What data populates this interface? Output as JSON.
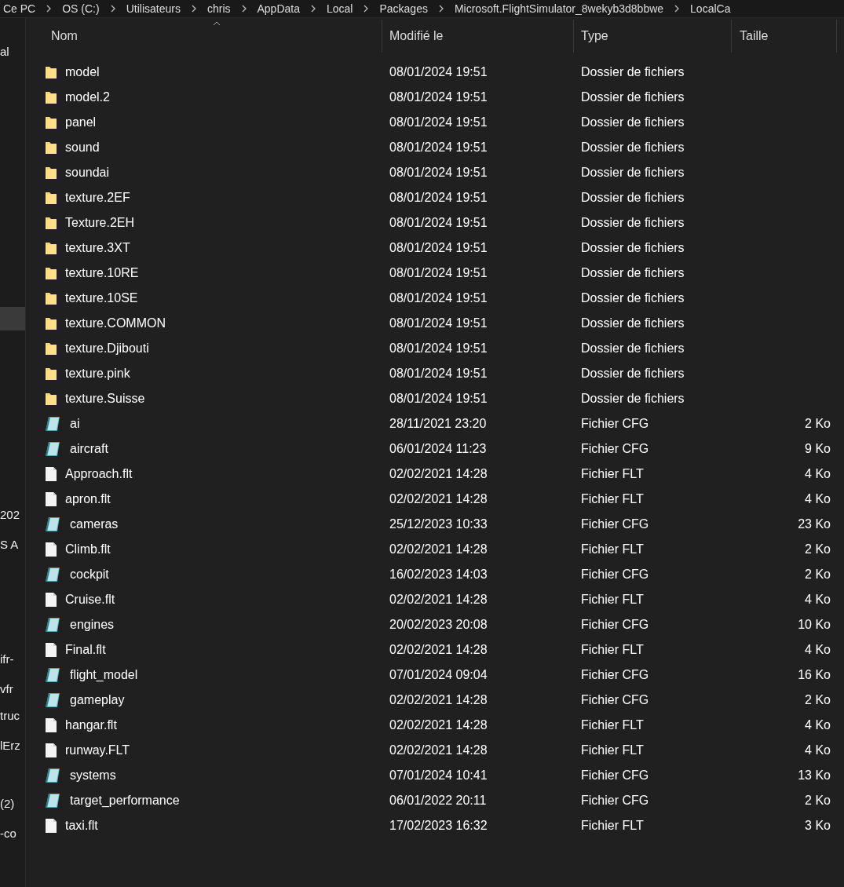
{
  "breadcrumb": [
    "Ce PC",
    "OS (C:)",
    "Utilisateurs",
    "chris",
    "AppData",
    "Local",
    "Packages",
    "Microsoft.FlightSimulator_8wekyb3d8bbwe",
    "LocalCa"
  ],
  "sidebar": {
    "items": [
      {
        "label": "al",
        "selected": false
      },
      {
        "selected": true
      },
      {
        "label": "202",
        "selected": false
      },
      {
        "label": "S A",
        "selected": false
      },
      {
        "label": "ifr-",
        "selected": false
      },
      {
        "label": "vfr",
        "selected": false
      },
      {
        "label": "truc",
        "selected": false
      },
      {
        "label": "lErz",
        "selected": false
      },
      {
        "label": "(2)",
        "selected": false
      },
      {
        "label": "-co",
        "selected": false
      }
    ]
  },
  "table": {
    "columns": [
      {
        "label": "Nom",
        "sorted": true
      },
      {
        "label": "Modifié le",
        "sorted": false
      },
      {
        "label": "Type",
        "sorted": false
      },
      {
        "label": "Taille",
        "sorted": false
      }
    ],
    "rows": [
      {
        "kind": "folder",
        "name": "model",
        "modified": "08/01/2024 19:51",
        "type": "Dossier de fichiers"
      },
      {
        "kind": "folder",
        "name": "model.2",
        "modified": "08/01/2024 19:51",
        "type": "Dossier de fichiers"
      },
      {
        "kind": "folder",
        "name": "panel",
        "modified": "08/01/2024 19:51",
        "type": "Dossier de fichiers"
      },
      {
        "kind": "folder",
        "name": "sound",
        "modified": "08/01/2024 19:51",
        "type": "Dossier de fichiers"
      },
      {
        "kind": "folder",
        "name": "soundai",
        "modified": "08/01/2024 19:51",
        "type": "Dossier de fichiers"
      },
      {
        "kind": "folder",
        "name": "texture.2EF",
        "modified": "08/01/2024 19:51",
        "type": "Dossier de fichiers"
      },
      {
        "kind": "folder",
        "name": "Texture.2EH",
        "modified": "08/01/2024 19:51",
        "type": "Dossier de fichiers"
      },
      {
        "kind": "folder",
        "name": "texture.3XT",
        "modified": "08/01/2024 19:51",
        "type": "Dossier de fichiers"
      },
      {
        "kind": "folder",
        "name": "texture.10RE",
        "modified": "08/01/2024 19:51",
        "type": "Dossier de fichiers"
      },
      {
        "kind": "folder",
        "name": "texture.10SE",
        "modified": "08/01/2024 19:51",
        "type": "Dossier de fichiers"
      },
      {
        "kind": "folder",
        "name": "texture.COMMON",
        "modified": "08/01/2024 19:51",
        "type": "Dossier de fichiers"
      },
      {
        "kind": "folder",
        "name": "texture.Djibouti",
        "modified": "08/01/2024 19:51",
        "type": "Dossier de fichiers"
      },
      {
        "kind": "folder",
        "name": "texture.pink",
        "modified": "08/01/2024 19:51",
        "type": "Dossier de fichiers"
      },
      {
        "kind": "folder",
        "name": "texture.Suisse",
        "modified": "08/01/2024 19:51",
        "type": "Dossier de fichiers"
      },
      {
        "kind": "cfg",
        "name": "ai",
        "modified": "28/11/2021 23:20",
        "type": "Fichier CFG",
        "size": "2 Ko"
      },
      {
        "kind": "cfg",
        "name": "aircraft",
        "modified": "06/01/2024 11:23",
        "type": "Fichier CFG",
        "size": "9 Ko"
      },
      {
        "kind": "file",
        "name": "Approach.flt",
        "modified": "02/02/2021 14:28",
        "type": "Fichier FLT",
        "size": "4 Ko"
      },
      {
        "kind": "file",
        "name": "apron.flt",
        "modified": "02/02/2021 14:28",
        "type": "Fichier FLT",
        "size": "4 Ko"
      },
      {
        "kind": "cfg",
        "name": "cameras",
        "modified": "25/12/2023 10:33",
        "type": "Fichier CFG",
        "size": "23 Ko"
      },
      {
        "kind": "file",
        "name": "Climb.flt",
        "modified": "02/02/2021 14:28",
        "type": "Fichier FLT",
        "size": "2 Ko"
      },
      {
        "kind": "cfg",
        "name": "cockpit",
        "modified": "16/02/2023 14:03",
        "type": "Fichier CFG",
        "size": "2 Ko"
      },
      {
        "kind": "file",
        "name": "Cruise.flt",
        "modified": "02/02/2021 14:28",
        "type": "Fichier FLT",
        "size": "4 Ko"
      },
      {
        "kind": "cfg",
        "name": "engines",
        "modified": "20/02/2023 20:08",
        "type": "Fichier CFG",
        "size": "10 Ko"
      },
      {
        "kind": "file",
        "name": "Final.flt",
        "modified": "02/02/2021 14:28",
        "type": "Fichier FLT",
        "size": "4 Ko"
      },
      {
        "kind": "cfg",
        "name": "flight_model",
        "modified": "07/01/2024 09:04",
        "type": "Fichier CFG",
        "size": "16 Ko"
      },
      {
        "kind": "cfg",
        "name": "gameplay",
        "modified": "02/02/2021 14:28",
        "type": "Fichier CFG",
        "size": "2 Ko"
      },
      {
        "kind": "file",
        "name": "hangar.flt",
        "modified": "02/02/2021 14:28",
        "type": "Fichier FLT",
        "size": "4 Ko"
      },
      {
        "kind": "file",
        "name": "runway.FLT",
        "modified": "02/02/2021 14:28",
        "type": "Fichier FLT",
        "size": "4 Ko"
      },
      {
        "kind": "cfg",
        "name": "systems",
        "modified": "07/01/2024 10:41",
        "type": "Fichier CFG",
        "size": "13 Ko"
      },
      {
        "kind": "cfg",
        "name": "target_performance",
        "modified": "06/01/2022 20:11",
        "type": "Fichier CFG",
        "size": "2 Ko"
      },
      {
        "kind": "file",
        "name": "taxi.flt",
        "modified": "17/02/2023 16:32",
        "type": "Fichier FLT",
        "size": "3 Ko"
      }
    ]
  }
}
